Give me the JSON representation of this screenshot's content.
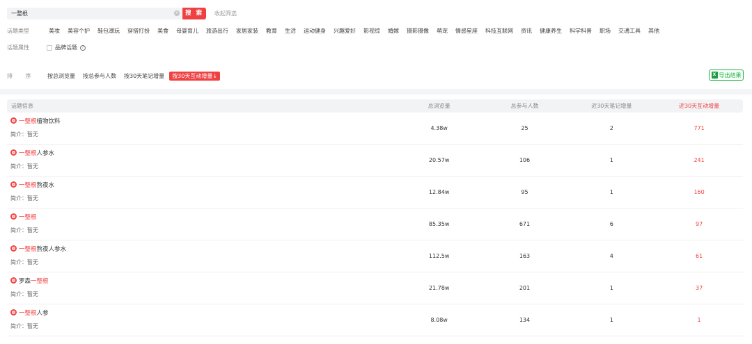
{
  "search": {
    "value": "一整根",
    "clear_glyph": "×",
    "button_label": "搜 索",
    "collapse_label": "收起筛选"
  },
  "filters": {
    "category_label": "话题类型",
    "categories": [
      "美妆",
      "美容个护",
      "鞋包潮玩",
      "穿搭打扮",
      "美食",
      "母婴育儿",
      "旅游出行",
      "家居家装",
      "教育",
      "生活",
      "运动健身",
      "兴趣爱好",
      "影视综",
      "婚嫁",
      "摄影摄像",
      "萌宠",
      "情感星座",
      "科技互联网",
      "资讯",
      "健康养生",
      "科学科普",
      "职场",
      "交通工具",
      "其他"
    ],
    "attribute_label": "话题属性",
    "brand_topic_label": "品牌话题",
    "help_glyph": "?"
  },
  "sort": {
    "label": "排 序",
    "options": [
      "按总浏览量",
      "按总参与人数",
      "按30天笔记增量",
      "按30天互动增量"
    ],
    "active_suffix": "↓",
    "export_label": "导出结果",
    "export_icon_glyph": "X"
  },
  "table": {
    "headers": [
      "话题信息",
      "总浏览量",
      "总参与人数",
      "近30天笔记增量",
      "近30天互动增量"
    ],
    "desc_label": "简介：",
    "rows": [
      {
        "prefix": "",
        "keyword": "一整根",
        "suffix": "植物饮料",
        "desc": "暂无",
        "views": "4.38w",
        "participants": "25",
        "notes_30d": "2",
        "interactions_30d": "771"
      },
      {
        "prefix": "",
        "keyword": "一整根",
        "suffix": "人参水",
        "desc": "暂无",
        "views": "20.57w",
        "participants": "106",
        "notes_30d": "1",
        "interactions_30d": "241"
      },
      {
        "prefix": "",
        "keyword": "一整根",
        "suffix": "熬夜水",
        "desc": "暂无",
        "views": "12.84w",
        "participants": "95",
        "notes_30d": "1",
        "interactions_30d": "160"
      },
      {
        "prefix": "",
        "keyword": "一整根",
        "suffix": "",
        "desc": "暂无",
        "views": "85.35w",
        "participants": "671",
        "notes_30d": "6",
        "interactions_30d": "97"
      },
      {
        "prefix": "",
        "keyword": "一整根",
        "suffix": "熬夜人参水",
        "desc": "暂无",
        "views": "112.5w",
        "participants": "163",
        "notes_30d": "4",
        "interactions_30d": "61"
      },
      {
        "prefix": "罗森",
        "keyword": "一整根",
        "suffix": "",
        "desc": "暂无",
        "views": "21.78w",
        "participants": "201",
        "notes_30d": "1",
        "interactions_30d": "37"
      },
      {
        "prefix": "",
        "keyword": "一整根",
        "suffix": "人参",
        "desc": "暂无",
        "views": "8.08w",
        "participants": "134",
        "notes_30d": "1",
        "interactions_30d": "1"
      }
    ]
  },
  "colors": {
    "accent": "#f04142",
    "export_green": "#2bb24c"
  }
}
